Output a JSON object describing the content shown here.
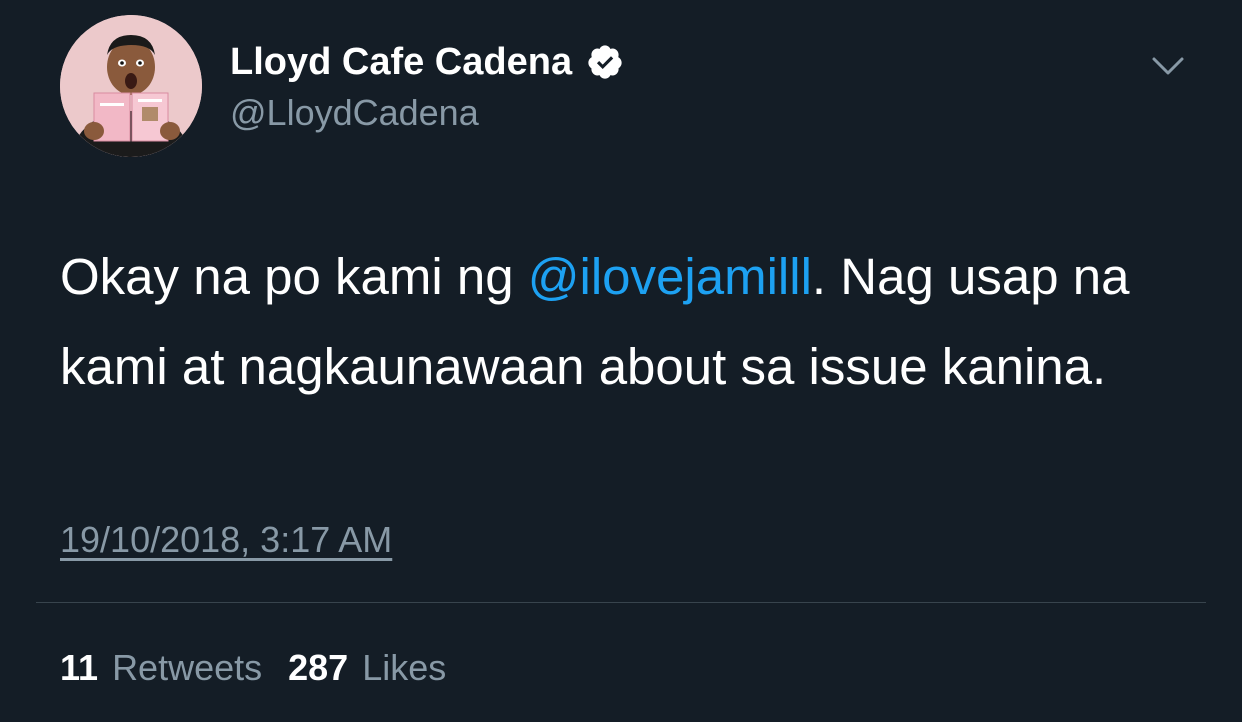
{
  "tweet": {
    "author": {
      "display_name": "Lloyd Cafe Cadena",
      "handle": "@LloydCadena",
      "verified": true
    },
    "text_before_mention": "Okay na po kami ng ",
    "mention": "@ilovejamilll",
    "text_after_mention": ". Nag usap na kami at nagkaunawaan about sa issue kanina.",
    "timestamp": "19/10/2018, 3:17 AM",
    "stats": {
      "retweets_count": "11",
      "retweets_label": "Retweets",
      "likes_count": "287",
      "likes_label": "Likes"
    }
  },
  "icons": {
    "verified": "verified-badge-icon",
    "menu": "chevron-down-icon"
  },
  "colors": {
    "background": "#141d26",
    "primary_text": "#ffffff",
    "secondary_text": "#8899a6",
    "link": "#1da1f2",
    "divider": "#38444d"
  }
}
